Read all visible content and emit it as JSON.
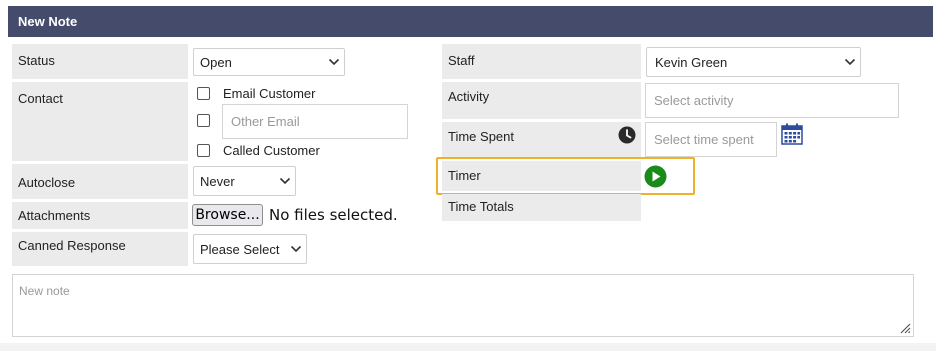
{
  "header": {
    "title": "New Note"
  },
  "left": {
    "status": {
      "label": "Status",
      "value": "Open"
    },
    "contact": {
      "label": "Contact",
      "email_customer": "Email Customer",
      "other_email_placeholder": "Other Email",
      "called_customer": "Called Customer"
    },
    "autoclose": {
      "label": "Autoclose",
      "value": "Never"
    },
    "attachments": {
      "label": "Attachments",
      "browse": "Browse...",
      "no_file": "No files selected."
    },
    "canned": {
      "label": "Canned Response",
      "value": "Please Select"
    }
  },
  "right": {
    "staff": {
      "label": "Staff",
      "value": "Kevin Green"
    },
    "activity": {
      "label": "Activity",
      "placeholder": "Select activity"
    },
    "time_spent": {
      "label": "Time Spent",
      "placeholder": "Select time spent"
    },
    "timer": {
      "label": "Timer"
    },
    "time_totals": {
      "label": "Time Totals"
    }
  },
  "note": {
    "placeholder": "New note"
  },
  "colors": {
    "header_bg": "#454c6b",
    "highlight": "#f0b128",
    "play_green": "#1a8a1a",
    "calendar_blue": "#2c4c9c"
  },
  "icons": [
    "chevron-down-icon",
    "clock-icon",
    "calendar-icon",
    "play-icon",
    "resize-handle-icon"
  ]
}
